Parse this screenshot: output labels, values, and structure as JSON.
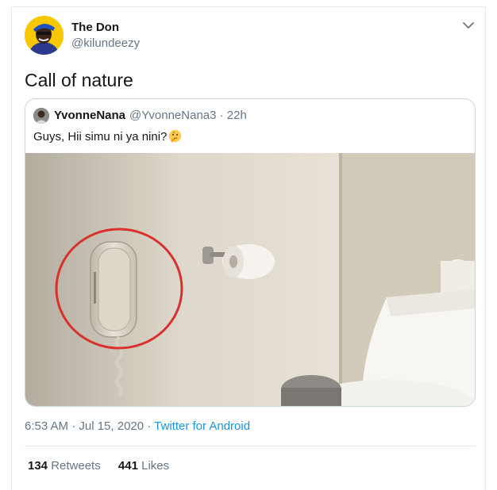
{
  "tweet": {
    "display_name": "The Don",
    "handle": "@kilundeezy",
    "text": "Call of nature",
    "timestamp": "6:53 AM · Jul 15, 2020 · ",
    "source": "Twitter for Android",
    "retweets": "134",
    "retweets_label": " Retweets",
    "likes": "441",
    "likes_label": " Likes"
  },
  "quoted": {
    "display_name": "YvonneNana",
    "handle": "@YvonneNana3 · 22h",
    "text": "Guys, Hii simu ni ya nini?",
    "emoji": "thinking-face-icon"
  },
  "icons": {
    "menu": "chevron-down-icon"
  },
  "colors": {
    "accent": "#1b95e0",
    "secondary_text": "#657786",
    "border": "#ccd6dd",
    "highlight_circle": "#d9302c"
  }
}
